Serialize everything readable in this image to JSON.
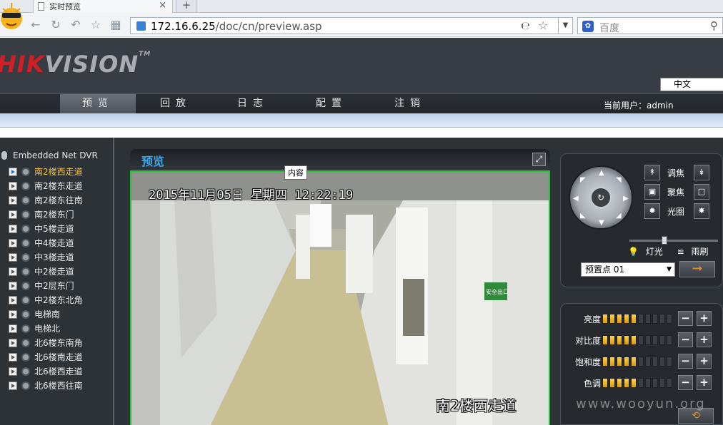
{
  "browser": {
    "tab_title": "实时预览",
    "tab_close": "×",
    "new_tab": "+",
    "url_host": "172.16.6.25",
    "url_path": "/doc/cn/preview.asp",
    "search_placeholder": "百度"
  },
  "header": {
    "logo_red": "HIK",
    "logo_gray": "VISION",
    "logo_tm": "TM",
    "language": "中文"
  },
  "menu": {
    "items": [
      {
        "label": "预览",
        "active": true
      },
      {
        "label": "回放",
        "active": false
      },
      {
        "label": "日志",
        "active": false
      },
      {
        "label": "配置",
        "active": false
      },
      {
        "label": "注销",
        "active": false
      }
    ],
    "current_user": "当前用户：admin"
  },
  "sidebar": {
    "title": "Embedded Net DVR",
    "cameras": [
      "南2楼西走道",
      "南2楼东走道",
      "南2楼东往南",
      "南2楼东门",
      "中5楼走道",
      "中4楼走道",
      "中3楼走道",
      "中2楼走道",
      "中2层东门",
      "中2楼东北角",
      "电梯南",
      "电梯北",
      "北6楼东南角",
      "北6楼南走道",
      "北6楼西走道",
      "北6楼西往南"
    ],
    "active_index": 0
  },
  "preview": {
    "title": "预览",
    "tooltip": "内容",
    "osd_time": "2015年11月05日  星期四  12:22:19",
    "osd_name": "南2楼西走道",
    "exit_sign": "安全出口"
  },
  "ptz": {
    "zoom_label": "调焦",
    "focus_label": "聚焦",
    "iris_label": "光圈",
    "light_label": "灯光",
    "wiper_label": "雨刷",
    "speed_level": 0.4,
    "preset_value": "预置点 01"
  },
  "adjust": {
    "rows": [
      {
        "label": "亮度",
        "level": 5
      },
      {
        "label": "对比度",
        "level": 5
      },
      {
        "label": "饱和度",
        "level": 5
      },
      {
        "label": "色调",
        "level": 5
      }
    ],
    "max_level": 10
  },
  "watermark": "www.wooyun.org",
  "colors": {
    "active_camera": "#f4c242",
    "preview_title": "#3ea5e8",
    "video_border": "#24c43a",
    "logo_red": "#d21f25"
  }
}
